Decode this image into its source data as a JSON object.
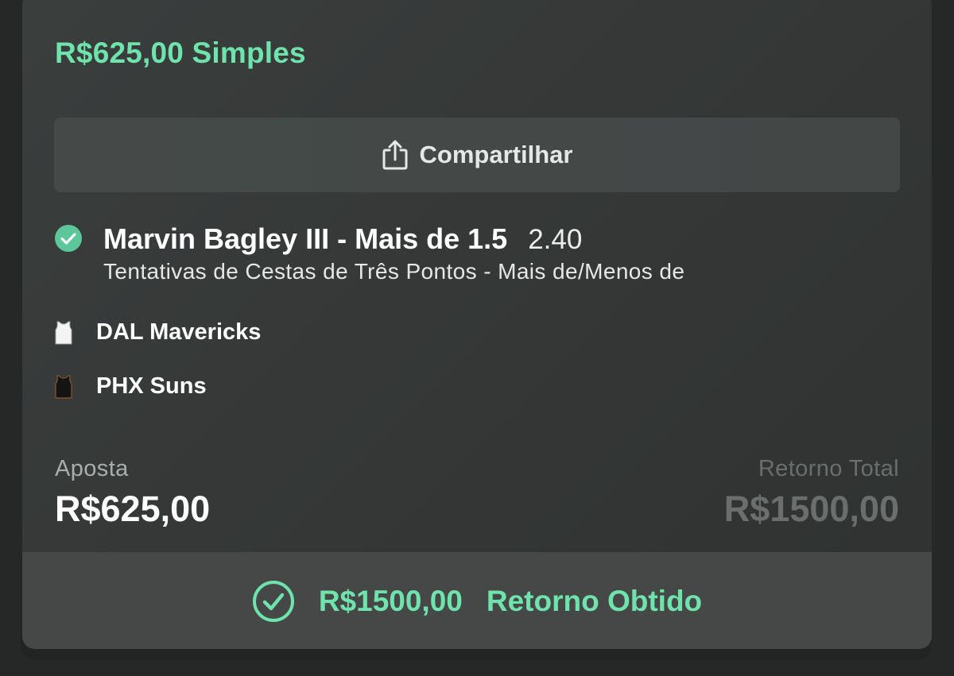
{
  "bet": {
    "title": "R$625,00 Simples"
  },
  "share": {
    "label": "Compartilhar",
    "icon": "share-icon"
  },
  "selection": {
    "status_icon": "check-circle-icon",
    "name": "Marvin Bagley III - Mais de 1.5",
    "odds": "2.40",
    "market": "Tentativas de Cestas de Três Pontos - Mais de/Menos de"
  },
  "teams": [
    {
      "name": "DAL Mavericks",
      "icon": "jersey-white-icon"
    },
    {
      "name": "PHX Suns",
      "icon": "jersey-black-icon"
    }
  ],
  "stake": {
    "label": "Aposta",
    "amount": "R$625,00"
  },
  "total_return": {
    "label": "Retorno Total",
    "amount": "R$1500,00"
  },
  "result": {
    "amount": "R$1500,00",
    "label": "Retorno Obtido",
    "icon": "check-circle-outline-icon"
  },
  "colors": {
    "accent_green": "#6fe3ac",
    "card_background": "#363938",
    "footer_background": "#464848"
  }
}
